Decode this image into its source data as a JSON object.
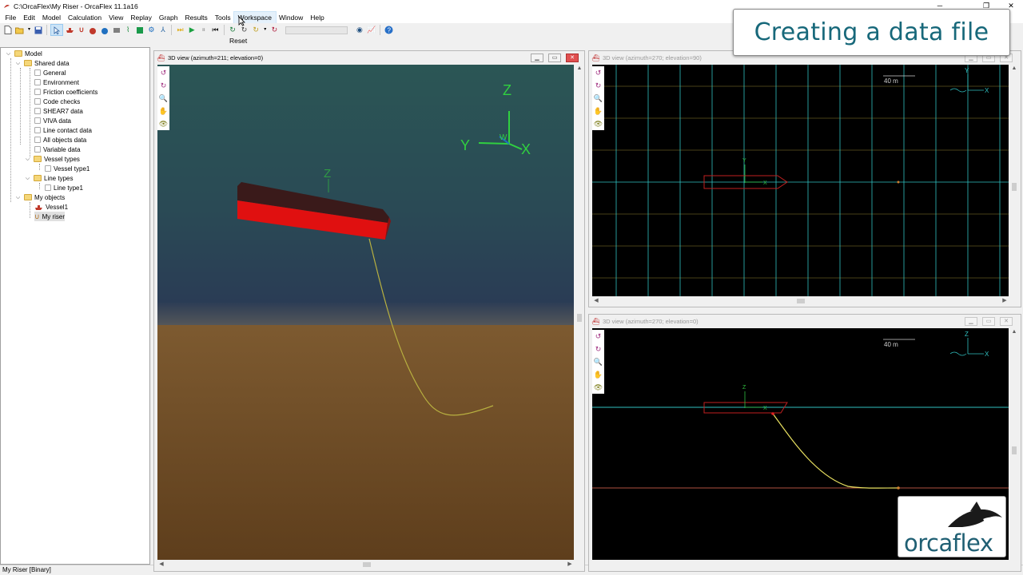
{
  "window": {
    "title": "C:\\OrcaFlex\\My Riser - OrcaFlex 11.1a16",
    "controls": {
      "minimize": "─",
      "maximize": "❐",
      "close": "✕"
    }
  },
  "menu": [
    "File",
    "Edit",
    "Model",
    "Calculation",
    "View",
    "Replay",
    "Graph",
    "Results",
    "Tools",
    "Workspace",
    "Window",
    "Help"
  ],
  "menu_hover": "Workspace",
  "tooltip": "Reset",
  "banner": "Creating a data file",
  "tree": {
    "root": "Model",
    "shared_data": "Shared data",
    "shared_items": [
      "General",
      "Environment",
      "Friction coefficients",
      "Code checks",
      "SHEAR7 data",
      "VIVA data",
      "Line contact data",
      "All objects data",
      "Variable data"
    ],
    "vessel_types": "Vessel types",
    "vessel_type_items": [
      "Vessel type1"
    ],
    "line_types": "Line types",
    "line_type_items": [
      "Line type1"
    ],
    "my_objects": "My objects",
    "object_items": [
      "Vessel1",
      "My riser"
    ]
  },
  "status": "My Riser [Binary]",
  "views": {
    "main": {
      "title": "3D view (azimuth=211; elevation=0)",
      "axes": {
        "z": "Z",
        "y": "Y",
        "x": "X",
        "w": "W"
      },
      "vessel_axis": "Z"
    },
    "plan": {
      "title": "3D view (azimuth=270; elevation=90)",
      "scale": "40 m",
      "axes": {
        "y": "Y",
        "x": "X"
      }
    },
    "elev": {
      "title": "3D view (azimuth=270; elevation=0)",
      "scale": "40 m",
      "axes": {
        "z": "Z",
        "x": "X"
      }
    }
  },
  "logo": {
    "text": "orcaflex"
  },
  "colors": {
    "sea": "#2b4f52",
    "seabed": "#7a5528",
    "vessel": "#e01010",
    "riser": "#d8c84a",
    "grid": "#30c0c0"
  }
}
